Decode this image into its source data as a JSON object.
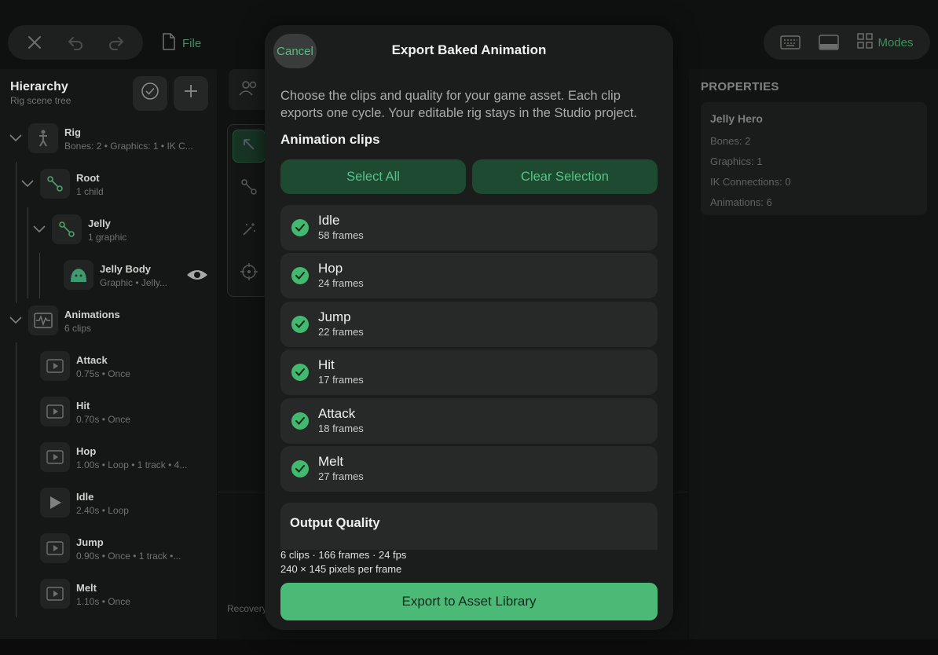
{
  "topbar": {
    "file_label": "File",
    "modes_label": "Modes"
  },
  "hierarchy": {
    "title": "Hierarchy",
    "subtitle": "Rig scene tree",
    "nodes": [
      {
        "name": "Rig",
        "meta": "Bones: 2  •  Graphics: 1  •  IK C..."
      },
      {
        "name": "Root",
        "meta": "1 child"
      },
      {
        "name": "Jelly",
        "meta": "1 graphic"
      },
      {
        "name": "Jelly Body",
        "meta": "Graphic  •  Jelly..."
      },
      {
        "name": "Animations",
        "meta": "6 clips"
      },
      {
        "name": "Attack",
        "meta": "0.75s  •  Once"
      },
      {
        "name": "Hit",
        "meta": "0.70s  •  Once"
      },
      {
        "name": "Hop",
        "meta": "1.00s  •  Loop  •  1 track  •  4..."
      },
      {
        "name": "Idle",
        "meta": "2.40s  •  Loop"
      },
      {
        "name": "Jump",
        "meta": "0.90s  •  Once  •  1 track  •..."
      },
      {
        "name": "Melt",
        "meta": "1.10s  •  Once"
      }
    ]
  },
  "canvas": {
    "recovery_label": "Recovery"
  },
  "properties": {
    "title": "PROPERTIES",
    "name": "Jelly Hero",
    "lines": [
      "Bones: 2",
      "Graphics: 1",
      "IK Connections: 0",
      "Animations: 6"
    ]
  },
  "modal": {
    "cancel_label": "Cancel",
    "title": "Export Baked Animation",
    "description": "Choose the clips and quality for your game asset. Each clip exports one cycle. Your editable rig stays in the Studio project.",
    "section_label": "Animation clips",
    "select_all_label": "Select All",
    "clear_selection_label": "Clear Selection",
    "clips": [
      {
        "name": "Idle",
        "frames": "58 frames",
        "checked": true
      },
      {
        "name": "Hop",
        "frames": "24 frames",
        "checked": true
      },
      {
        "name": "Jump",
        "frames": "22 frames",
        "checked": true
      },
      {
        "name": "Hit",
        "frames": "17 frames",
        "checked": true
      },
      {
        "name": "Attack",
        "frames": "18 frames",
        "checked": true
      },
      {
        "name": "Melt",
        "frames": "27 frames",
        "checked": true
      }
    ],
    "output_quality_label": "Output Quality",
    "stats_line1": "6 clips · 166 frames · 24 fps",
    "stats_line2": "240 × 145 pixels per frame",
    "export_label": "Export to Asset Library"
  },
  "colors": {
    "accent": "#4bba77",
    "check": "#43b970",
    "button_bg": "#1d4a31"
  }
}
